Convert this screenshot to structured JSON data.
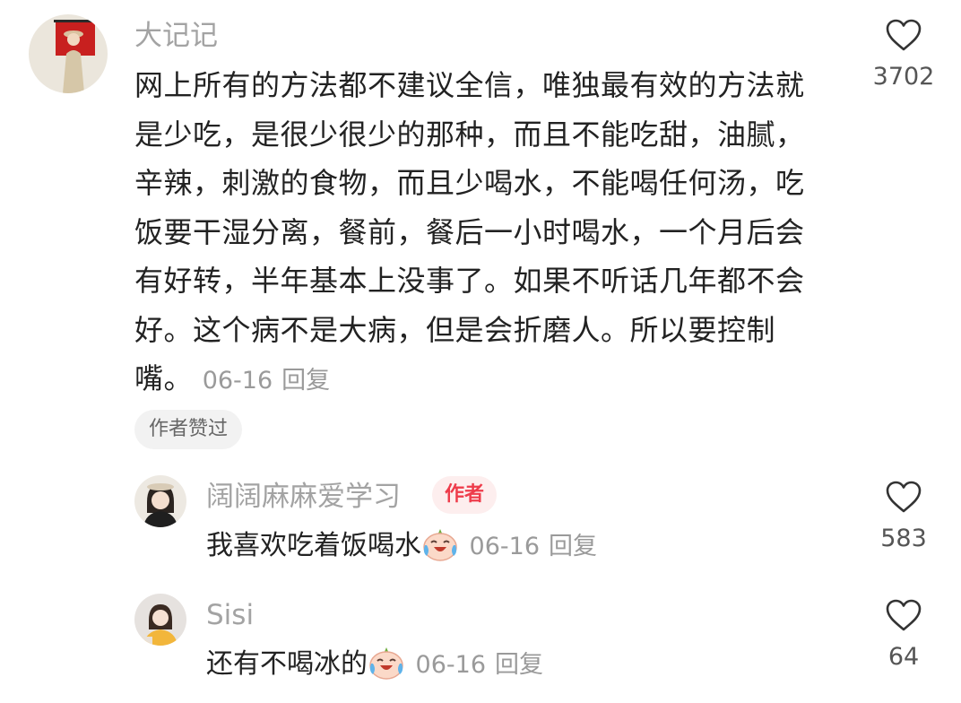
{
  "comments": [
    {
      "username": "大记记",
      "avatar": "person-in-hat-red-wall",
      "lines": [
        "网上所有的方法都不建议全信，唯独最有效的方法就",
        "是少吃，是很少很少的那种，而且不能吃甜，油腻，",
        "辛辣，刺激的食物，而且少喝水，不能喝任何汤，吃",
        "饭要干湿分离，餐前，餐后一小时喝水，一个月后会",
        "有好转，半年基本上没事了。如果不听话几年都不会",
        "好。这个病不是大病，但是会折磨人。所以要控制",
        "嘴。"
      ],
      "date": "06-16",
      "reply_label": "回复",
      "like_count": "3702",
      "author_liked_label": "作者赞过"
    }
  ],
  "replies": [
    {
      "username": "阔阔麻麻爱学习",
      "badge": "作者",
      "text": "我喜欢吃着饭喝水",
      "emoji": "crying-laughing-face",
      "date": "06-16",
      "reply_label": "回复",
      "like_count": "583"
    },
    {
      "username": "Sisi",
      "text": "还有不喝冰的",
      "emoji": "crying-laughing-face",
      "date": "06-16",
      "reply_label": "回复",
      "like_count": "64"
    }
  ],
  "icons": {
    "like": "heart-outline-icon"
  },
  "colors": {
    "username": "#a3a3a3",
    "text": "#222222",
    "meta": "#9a9a9a",
    "badge_bg": "#fdeeee",
    "badge_text": "#ee3c4b"
  }
}
